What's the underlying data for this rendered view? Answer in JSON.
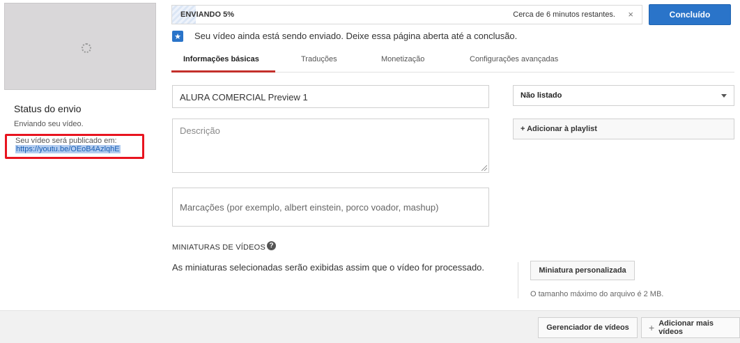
{
  "left": {
    "status_title": "Status do envio",
    "status_text": "Enviando seu vídeo.",
    "publish_label": "Seu vídeo será publicado em:",
    "publish_link": "https://youtu.be/OEoB4AzlqhE",
    "highlight_color": "#e8141f"
  },
  "upload": {
    "progress_label": "ENVIANDO 5%",
    "progress_percent": 5,
    "time_left": "Cerca de 6 minutos restantes.",
    "close_icon": "×",
    "done_label": "Concluído",
    "notice": "Seu vídeo ainda está sendo enviado. Deixe essa página aberta até a conclusão.",
    "star_icon": "★"
  },
  "tabs": [
    {
      "label": "Informações básicas",
      "active": true
    },
    {
      "label": "Traduções",
      "active": false
    },
    {
      "label": "Monetização",
      "active": false
    },
    {
      "label": "Configurações avançadas",
      "active": false
    }
  ],
  "form": {
    "title_value": "ALURA COMERCIAL Preview 1",
    "description_placeholder": "Descrição",
    "tags_placeholder": "Marcações (por exemplo, albert einstein, porco voador, mashup)",
    "privacy_value": "Não listado",
    "playlist_label": "+ Adicionar à playlist"
  },
  "thumbnails": {
    "title": "MINIATURAS DE VÍDEOS",
    "help_icon": "?",
    "info": "As miniaturas selecionadas serão exibidas assim que o vídeo for processado.",
    "custom_button": "Miniatura personalizada",
    "max_size": "O tamanho máximo do arquivo é 2 MB."
  },
  "footer": {
    "manager_label": "Gerenciador de vídeos",
    "add_more_label": "Adicionar mais vídeos",
    "plus_icon": "+"
  },
  "colors": {
    "accent": "#2a74c9",
    "tab_underline": "#c4302b"
  }
}
